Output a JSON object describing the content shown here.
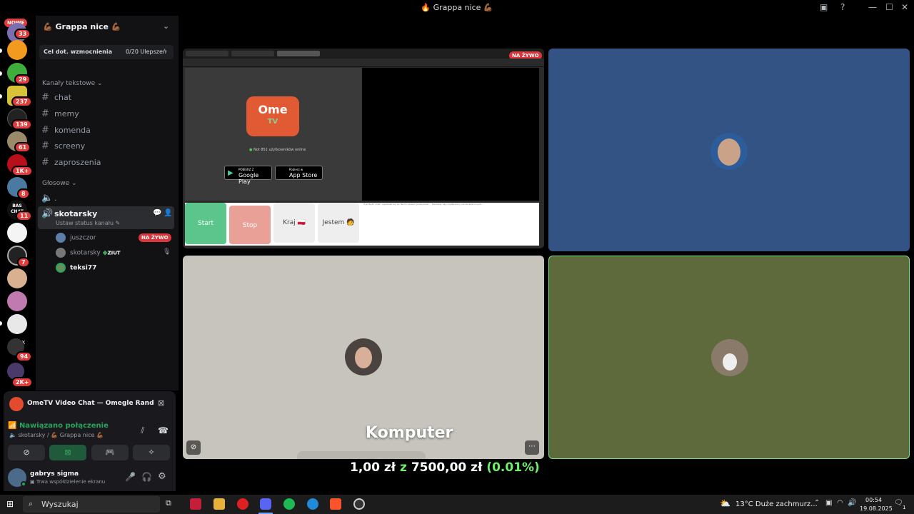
{
  "window": {
    "title": "🔥 Grappa nice 💪🏾"
  },
  "rail": {
    "new_label": "NOWE",
    "badges": [
      "33",
      "29",
      "237",
      "139",
      "61",
      "1K+",
      "8",
      "11",
      "7",
      "94",
      "2K+"
    ],
    "bas_label": "BAS\nCHAT",
    "sx_label": "SX"
  },
  "server": {
    "name": "💪🏾 Grappa nice 💪🏾",
    "boost_label": "Cel dot. wzmocnienia",
    "boost_progress": "0/20 Ulepszeń",
    "text_category": "Kanały tekstowe",
    "text_channels": [
      "chat",
      "memy",
      "komenda",
      "screeny",
      "zaproszenia"
    ],
    "voice_category": "Głosowe",
    "voice_channels": [
      ".",
      "skotarsky"
    ],
    "active_channel_status": "Ustaw status kanału",
    "members": [
      {
        "name": "juszczor",
        "live": "NA ŻYWO"
      },
      {
        "name": "skotarsky",
        "tag": "ZIUT"
      },
      {
        "name": "teksi77"
      }
    ]
  },
  "activity": {
    "title": "OmeTV Video Chat — Omegle Random Ca..."
  },
  "voice": {
    "status": "Nawiązano połączenie",
    "location": "skotarsky / 💪🏾 Grappa nice 💪🏾"
  },
  "user": {
    "name": "gabrys sigma",
    "status": "Trwa współdzielenie ekranu"
  },
  "stream": {
    "live_label": "NA ŻYWO",
    "ome_logo": "Ome",
    "ome_tv": "TV",
    "online_count": "Not 851 użytkowników online",
    "google_play_small": "POBIERZ Z",
    "google_play": "Google Play",
    "app_store_small": "Pobierz w",
    "app_store": "App Store",
    "start_label": "Start",
    "stop_label": "Stop",
    "country_label": "Kraj 🇵🇱",
    "gender_label": "Jestem 🧑",
    "chat_note": "Tryb Bądź „Czat” zgadzasz się, że Twoim czasem przesyłania ... Pamiętaj, aby użytkownicy nie obrażali innych..."
  },
  "overlay": {
    "name_label": "Komputer"
  },
  "donation": {
    "current": "1,00 zł",
    "sep": "z",
    "goal": "7500,00 zł",
    "percent": "(0.01%)"
  },
  "taskbar": {
    "search_placeholder": "Wyszukaj",
    "weather": "13°C  Duże zachmurz...",
    "time": "00:54",
    "date": "19.08.2025",
    "notif": "1"
  },
  "colors": {
    "tile_blue": "#335384",
    "tile_gray": "#c6c4bd",
    "tile_olive": "#5f6a3c",
    "live_red": "#da373c",
    "green": "#23a55a",
    "start_green": "#5cc58c",
    "stop_pink": "#e8a097",
    "percent_green": "#6ef06a"
  }
}
